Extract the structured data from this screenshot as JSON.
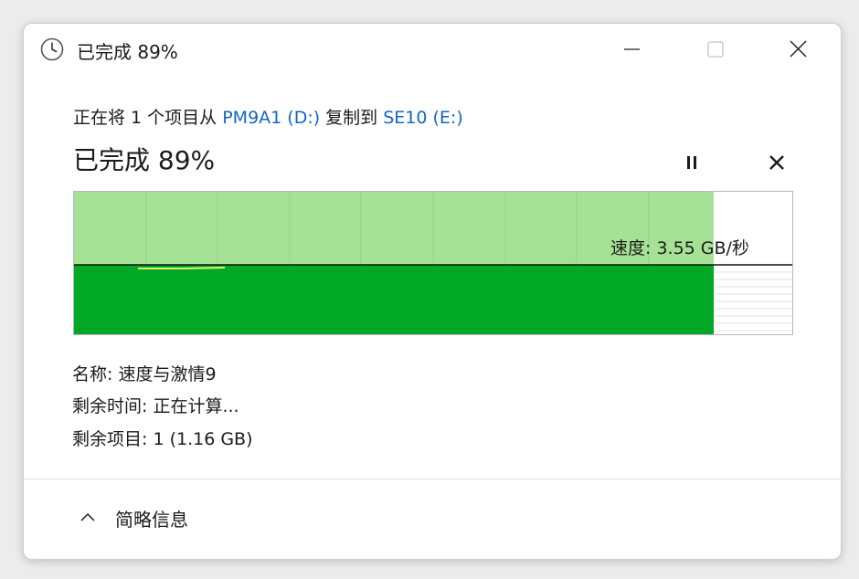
{
  "window": {
    "title": "已完成 89%",
    "icons": {
      "app": "clock-icon",
      "minimize": "minimize-icon",
      "maximize": "maximize-icon",
      "close": "close-icon"
    }
  },
  "copy": {
    "prefix": "正在将 1 个项目从 ",
    "source": "PM9A1 (D:)",
    "middle": " 复制到 ",
    "destination": "SE10 (E:)"
  },
  "progress": {
    "label": "已完成 89%",
    "percent": 89,
    "speed_label": "速度: 3.55 GB/秒",
    "pause_icon": "pause-icon",
    "cancel_icon": "cancel-icon"
  },
  "details": {
    "name": "名称: 速度与激情9",
    "time_remaining": "剩余时间: 正在计算...",
    "items_remaining": "剩余项目: 1 (1.16 GB)"
  },
  "footer": {
    "toggle_label": "简略信息",
    "toggle_icon": "chevron-up-icon"
  },
  "colors": {
    "progress_fill": "#00a825",
    "progress_light": "#a6e295",
    "speed_line": "#111111",
    "link_blue": "#1565c0"
  }
}
